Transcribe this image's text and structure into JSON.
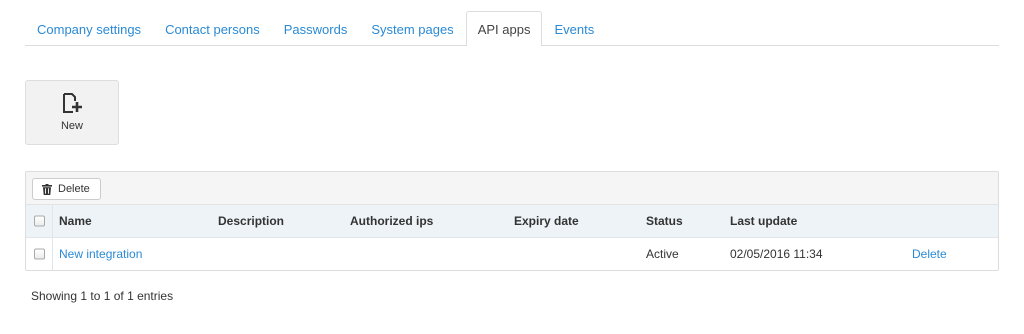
{
  "tabs": [
    {
      "label": "Company settings"
    },
    {
      "label": "Contact persons"
    },
    {
      "label": "Passwords"
    },
    {
      "label": "System pages"
    },
    {
      "label": "API apps",
      "active": true
    },
    {
      "label": "Events"
    }
  ],
  "new_button": {
    "label": "New",
    "icon": "add-document-icon"
  },
  "toolbar": {
    "delete_label": "Delete",
    "delete_icon": "trash-icon"
  },
  "table": {
    "columns": [
      "Name",
      "Description",
      "Authorized ips",
      "Expiry date",
      "Status",
      "Last update"
    ],
    "rows": [
      {
        "name": "New integration",
        "description": "",
        "authorized_ips": "",
        "expiry_date": "",
        "status": "Active",
        "last_update": "02/05/2016 11:34",
        "action": "Delete"
      }
    ]
  },
  "footer": {
    "text": "Showing 1 to 1 of 1 entries"
  },
  "colors": {
    "link": "#2a8ad4",
    "header_bg": "#eef3f7",
    "toolbar_bg": "#f5f5f5"
  }
}
